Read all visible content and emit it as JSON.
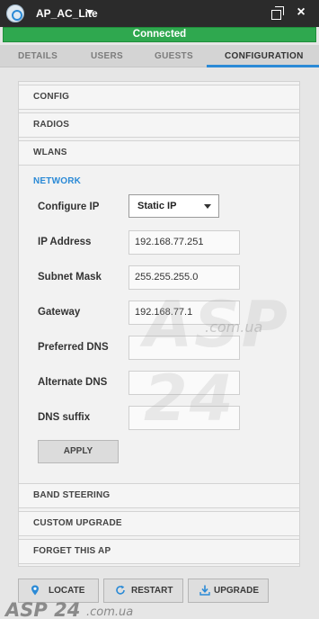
{
  "window": {
    "title": "AP_AC_Lite"
  },
  "status": {
    "text": "Connected",
    "color": "#2fa84f"
  },
  "tabs": [
    {
      "label": "DETAILS",
      "active": false
    },
    {
      "label": "USERS",
      "active": false
    },
    {
      "label": "GUESTS",
      "active": false
    },
    {
      "label": "CONFIGURATION",
      "active": true
    }
  ],
  "sections": {
    "config": "CONFIG",
    "radios": "RADIOS",
    "wlans": "WLANS",
    "network": "NETWORK",
    "band_steering": "BAND STEERING",
    "custom_upgrade": "CUSTOM UPGRADE",
    "forget_ap": "FORGET THIS AP"
  },
  "network": {
    "configure_ip": {
      "label": "Configure IP",
      "value": "Static IP"
    },
    "ip_address": {
      "label": "IP Address",
      "value": "192.168.77.251"
    },
    "subnet_mask": {
      "label": "Subnet Mask",
      "value": "255.255.255.0"
    },
    "gateway": {
      "label": "Gateway",
      "value": "192.168.77.1"
    },
    "preferred_dns": {
      "label": "Preferred DNS",
      "value": ""
    },
    "alternate_dns": {
      "label": "Alternate DNS",
      "value": ""
    },
    "dns_suffix": {
      "label": "DNS suffix",
      "value": ""
    },
    "apply_label": "APPLY"
  },
  "actions": {
    "locate": "LOCATE",
    "restart": "RESTART",
    "upgrade": "UPGRADE"
  },
  "watermark": {
    "logo": "ASP 24",
    "domain": ".com.ua"
  },
  "accent_color": "#2b8ad6"
}
